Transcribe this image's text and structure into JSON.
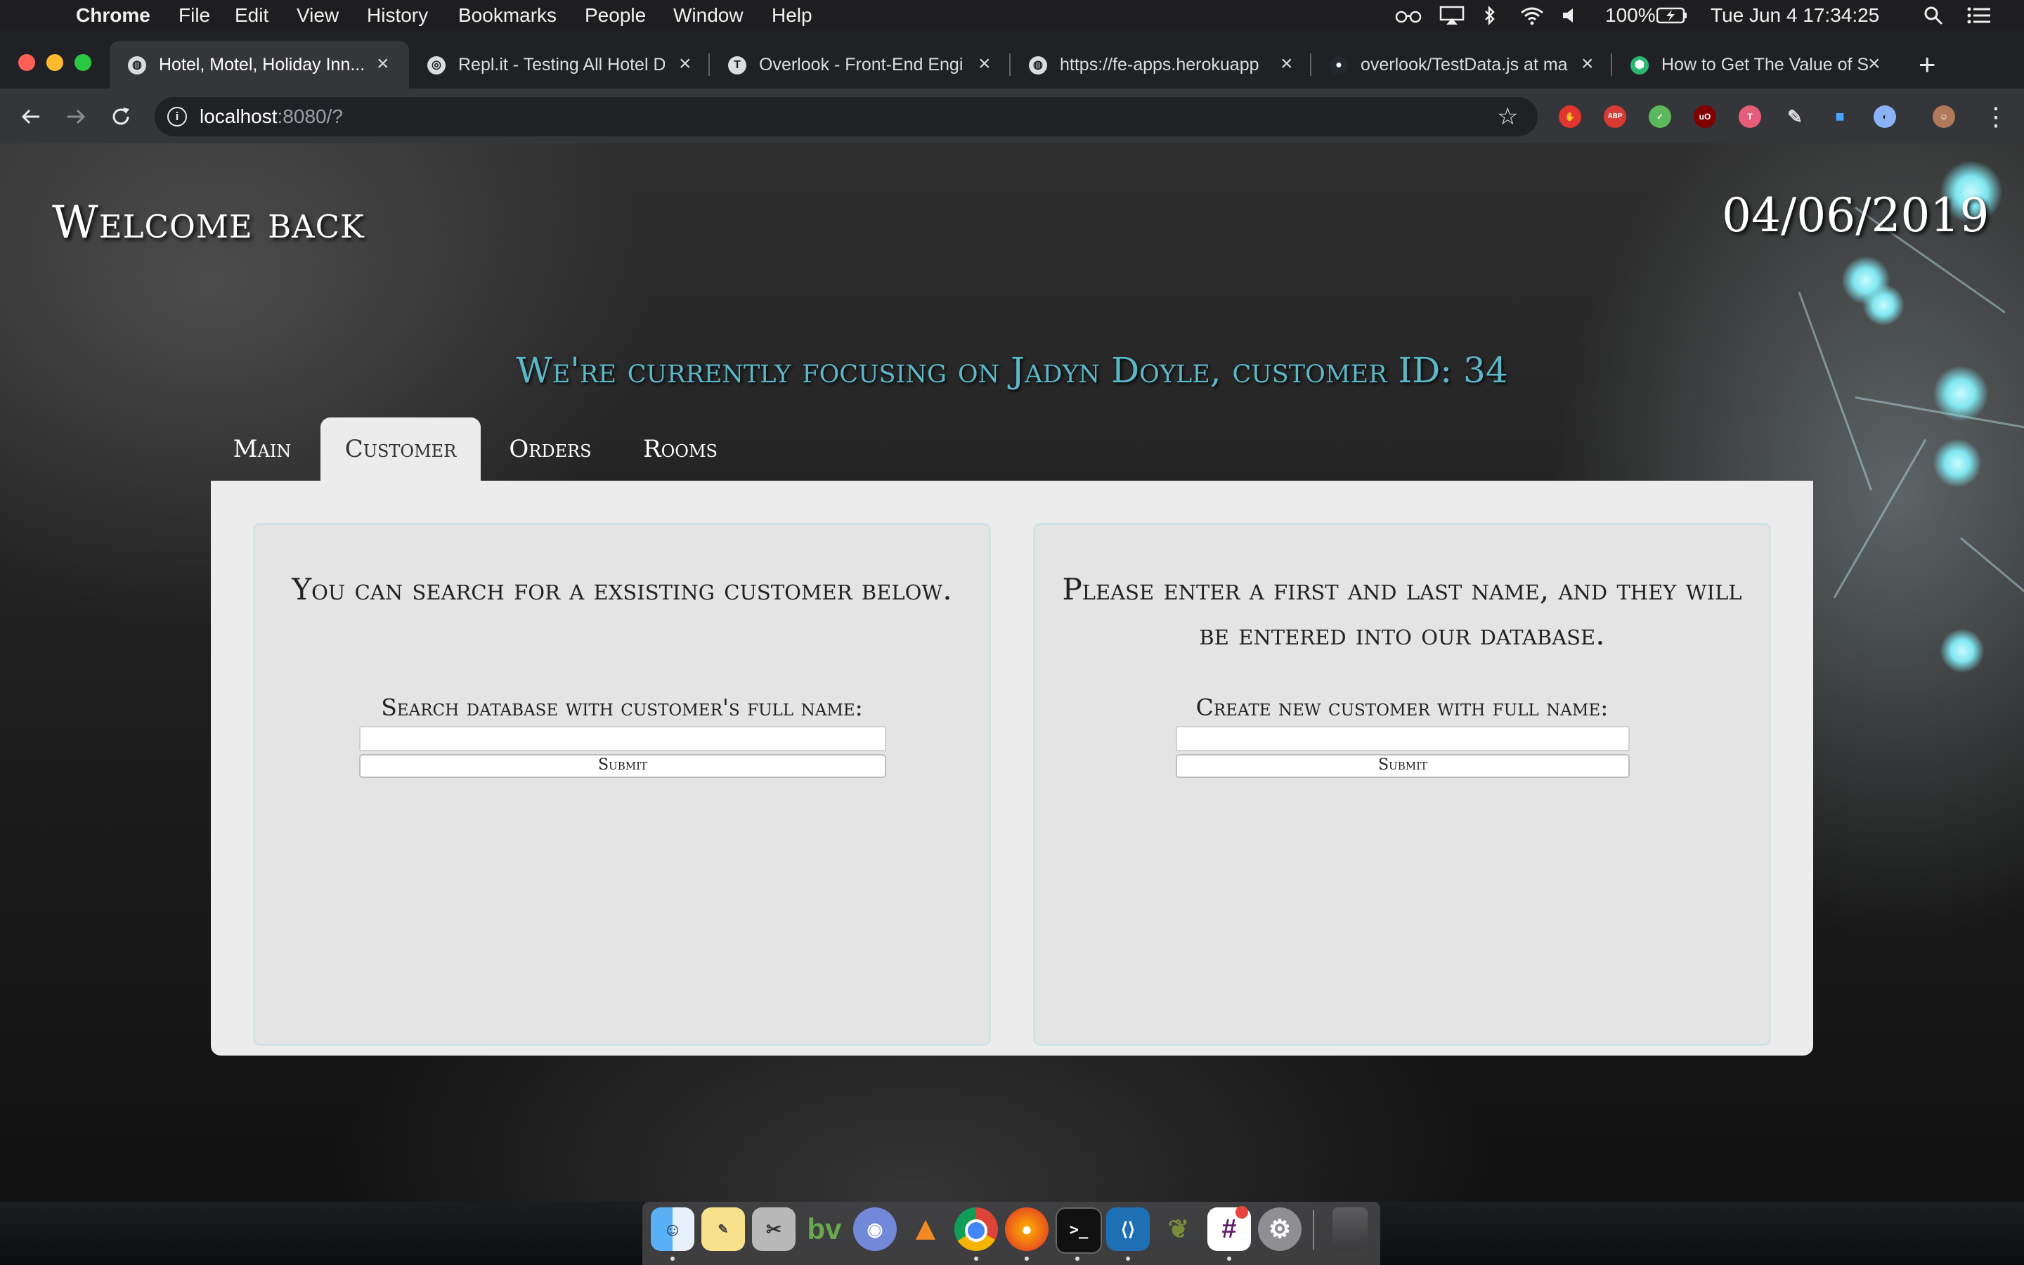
{
  "menubar": {
    "app": "Chrome",
    "menus": [
      "File",
      "Edit",
      "View",
      "History",
      "Bookmarks",
      "People",
      "Window",
      "Help"
    ],
    "battery": "100%",
    "clock": "Tue Jun 4  17:34:25"
  },
  "tabs": [
    {
      "title": "Hotel, Motel, Holiday Inn...",
      "icon": "globe-icon"
    },
    {
      "title": "Repl.it - Testing All Hotel D",
      "icon": "replit-icon"
    },
    {
      "title": "Overlook - Front-End Engi",
      "icon": "turing-icon"
    },
    {
      "title": "https://fe-apps.herokuapp",
      "icon": "globe-icon"
    },
    {
      "title": "overlook/TestData.js at ma",
      "icon": "github-icon"
    },
    {
      "title": "How to Get The Value of S",
      "icon": "codecademy-icon"
    }
  ],
  "address": {
    "host": "localhost",
    "rest": ":8080/?"
  },
  "page": {
    "welcome": "Welcome back",
    "date": "04/06/2019",
    "focus": "We're currently focusing on Jadyn Doyle, customer ID: 34",
    "nav": [
      "Main",
      "Customer",
      "Orders",
      "Rooms"
    ],
    "active_nav": "Customer",
    "search_card": {
      "heading": "You can search for a exsisting customer below.",
      "label": "Search database with customer's full name:",
      "input_value": "",
      "submit": "Submit"
    },
    "create_card": {
      "heading": "Please enter a first and last name, and they will be entered into our database.",
      "label": "Create new customer with full name:",
      "input_value": "",
      "submit": "Submit"
    }
  },
  "colors": {
    "accent_teal": "#5bb8c9",
    "panel_bg": "#ececec"
  }
}
